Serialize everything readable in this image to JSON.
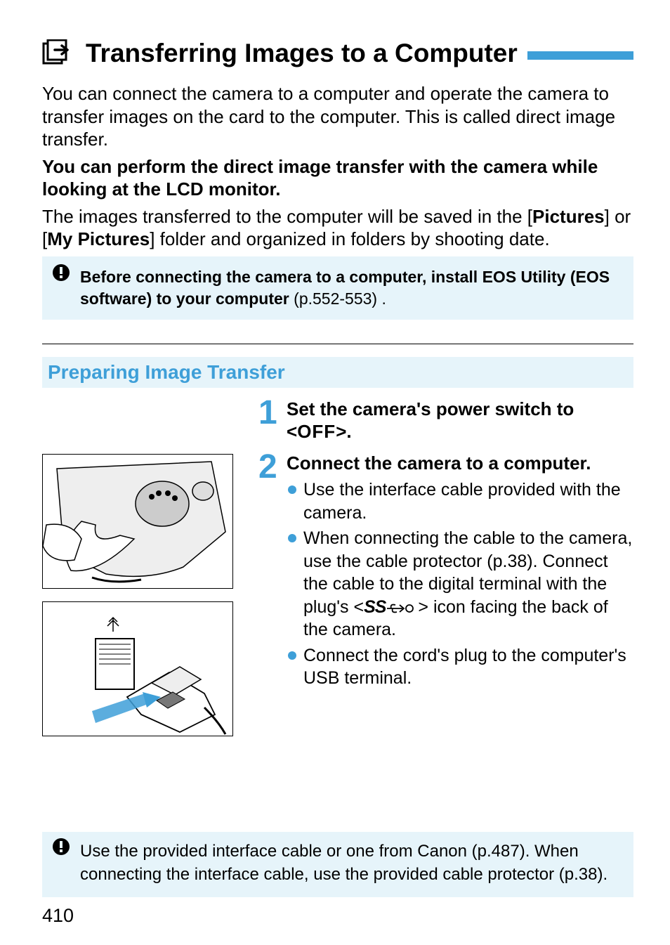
{
  "title": "Transferring Images to a Computer",
  "intro": {
    "p1": "You can connect the camera to a computer and operate the camera to transfer images on the card to the computer. This is called direct image transfer.",
    "p2_bold": "You can perform the direct image transfer with the camera while looking at the LCD monitor.",
    "p3_pre": "The images transferred to the computer will be saved in the [",
    "p3_b1": "Pictures",
    "p3_mid": "] or [",
    "p3_b2": "My Pictures",
    "p3_post": "] folder and organized in folders by shooting date."
  },
  "note1": {
    "bold": "Before connecting the camera to a computer, install EOS Utility (EOS software) to your computer",
    "rest": " (p.552-553) ."
  },
  "section_heading": "Preparing Image Transfer",
  "steps": {
    "s1": {
      "num": "1",
      "title_pre": "Set the camera's power switch to <",
      "title_sym": "OFF",
      "title_post": ">."
    },
    "s2": {
      "num": "2",
      "title": "Connect the camera to a computer.",
      "b1": "Use the interface cable provided with the camera.",
      "b2_pre": "When connecting the cable to the camera, use the cable protector (p.38). Connect the cable to the digital terminal with the plug's <",
      "b2_icon": "SS",
      "b2_post": "> icon facing the back of the camera.",
      "b3": "Connect the cord's plug to the computer's USB terminal."
    }
  },
  "note2": "Use the provided interface cable or one from Canon (p.487). When connecting the interface cable, use the provided cable protector (p.38).",
  "page_number": "410"
}
